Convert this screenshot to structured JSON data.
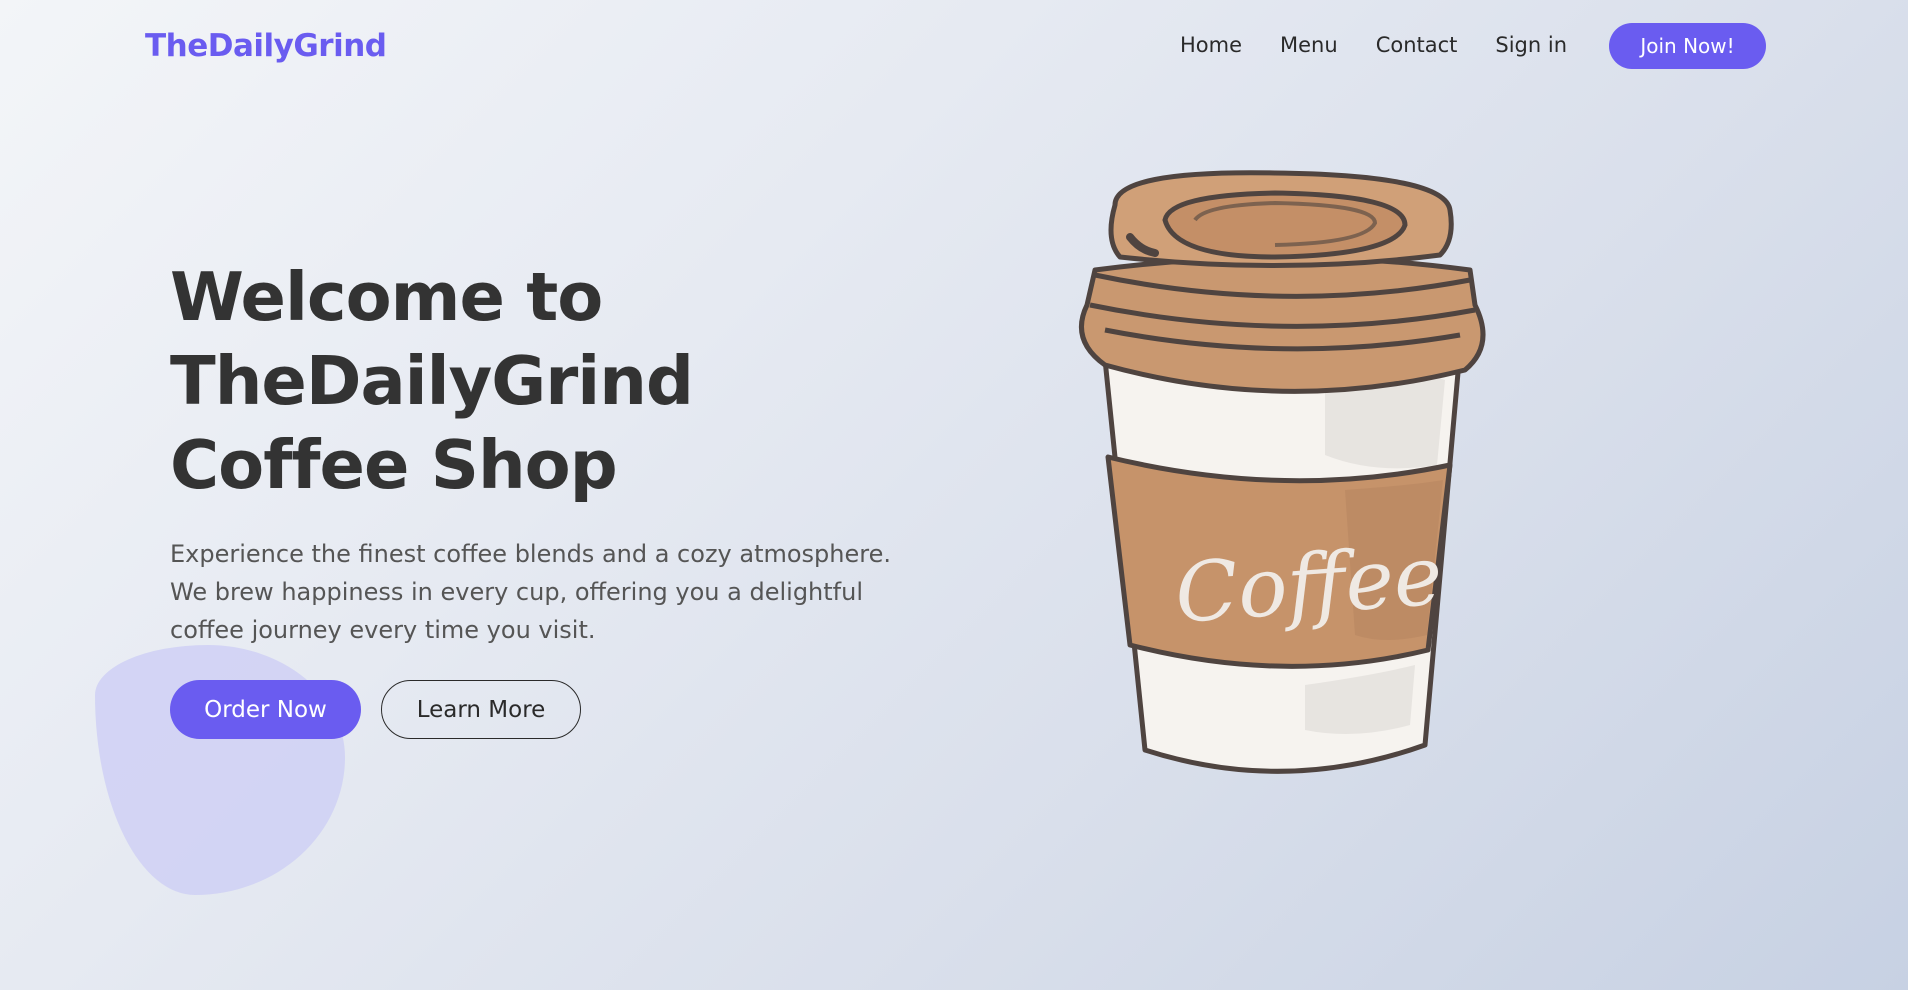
{
  "brand": {
    "logo_text": "TheDailyGrind",
    "accent_color": "#6a5cf0"
  },
  "nav": {
    "links": [
      "Home",
      "Menu",
      "Contact",
      "Sign in"
    ],
    "cta_label": "Join Now!"
  },
  "hero": {
    "title_lines": [
      "Welcome to",
      "TheDailyGrind",
      "Coffee Shop"
    ],
    "description_lines": [
      "Experience the finest coffee blends and a cozy atmosphere.",
      "We brew happiness in every cup, offering you a delightful",
      "coffee journey every time you visit."
    ],
    "primary_button": "Order Now",
    "secondary_button": "Learn More"
  },
  "illustration": {
    "icon": "coffee-cup-illustration",
    "sleeve_text": "Coffee"
  }
}
